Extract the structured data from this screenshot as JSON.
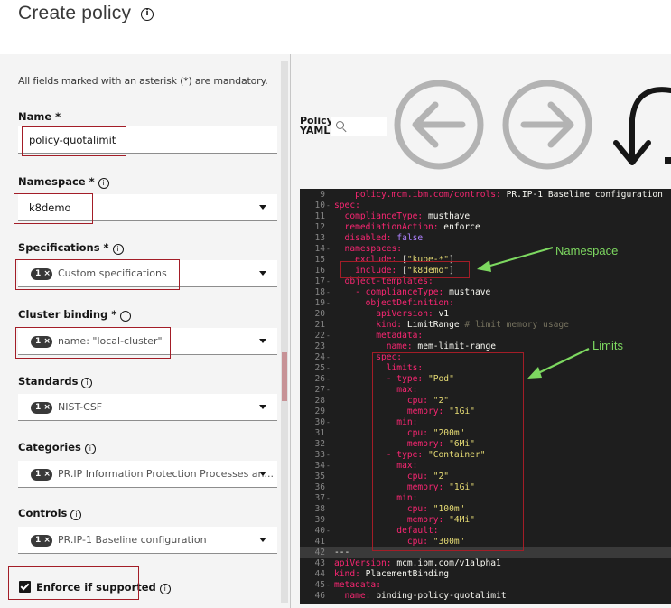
{
  "page": {
    "title": "Create policy"
  },
  "form": {
    "mandatory_note": "All fields marked with an asterisk (*) are mandatory.",
    "name": {
      "label": "Name *",
      "value": "policy-quotalimit"
    },
    "namespace": {
      "label": "Namespace *",
      "value": "k8demo"
    },
    "specifications": {
      "label": "Specifications *",
      "tag": "1",
      "value": "Custom specifications"
    },
    "cluster_binding": {
      "label": "Cluster binding *",
      "tag": "1",
      "value": "name: \"local-cluster\""
    },
    "standards": {
      "label": "Standards",
      "tag": "1",
      "value": "NIST-CSF"
    },
    "categories": {
      "label": "Categories",
      "tag": "1",
      "value": "PR.IP Information Protection Processes an..."
    },
    "controls": {
      "label": "Controls",
      "tag": "1",
      "value": "PR.IP-1 Baseline configuration"
    },
    "enforce": {
      "label": "Enforce if supported",
      "checked": true
    }
  },
  "yaml": {
    "label_line1": "Policy",
    "label_line2": "YAML",
    "lines": [
      {
        "n": "9",
        "fold": "",
        "seg": [
          [
            "    policy.mcm.ibm.com/controls: ",
            "k"
          ],
          [
            "PR.IP-1 Baseline configuration",
            "v"
          ]
        ]
      },
      {
        "n": "10",
        "fold": "-",
        "seg": [
          [
            "spec:",
            "k"
          ]
        ]
      },
      {
        "n": "11",
        "fold": "",
        "seg": [
          [
            "  complianceType: ",
            "k"
          ],
          [
            "musthave",
            "v"
          ]
        ]
      },
      {
        "n": "12",
        "fold": "",
        "seg": [
          [
            "  remediationAction: ",
            "k"
          ],
          [
            "enforce",
            "v"
          ]
        ]
      },
      {
        "n": "13",
        "fold": "",
        "seg": [
          [
            "  disabled: ",
            "k"
          ],
          [
            "false",
            "b"
          ]
        ]
      },
      {
        "n": "14",
        "fold": "-",
        "seg": [
          [
            "  namespaces:",
            "k"
          ]
        ]
      },
      {
        "n": "15",
        "fold": "",
        "seg": [
          [
            "    exclude: ",
            "k"
          ],
          [
            "[",
            "p"
          ],
          [
            "\"kube-*\"",
            "s"
          ],
          [
            "]",
            "p"
          ]
        ]
      },
      {
        "n": "16",
        "fold": "",
        "seg": [
          [
            "    include: ",
            "k"
          ],
          [
            "[",
            "p"
          ],
          [
            "\"k8demo\"",
            "s"
          ],
          [
            "]",
            "p"
          ]
        ]
      },
      {
        "n": "17",
        "fold": "-",
        "seg": [
          [
            "  object-templates:",
            "k"
          ]
        ]
      },
      {
        "n": "18",
        "fold": "-",
        "seg": [
          [
            "    - complianceType: ",
            "k"
          ],
          [
            "musthave",
            "v"
          ]
        ]
      },
      {
        "n": "19",
        "fold": "-",
        "seg": [
          [
            "      objectDefinition:",
            "k"
          ]
        ]
      },
      {
        "n": "20",
        "fold": "",
        "seg": [
          [
            "        apiVersion: ",
            "k"
          ],
          [
            "v1",
            "v"
          ]
        ]
      },
      {
        "n": "21",
        "fold": "",
        "seg": [
          [
            "        kind: ",
            "k"
          ],
          [
            "LimitRange ",
            "v"
          ],
          [
            "# limit memory usage",
            "c"
          ]
        ]
      },
      {
        "n": "22",
        "fold": "-",
        "seg": [
          [
            "        metadata:",
            "k"
          ]
        ]
      },
      {
        "n": "23",
        "fold": "",
        "seg": [
          [
            "          name: ",
            "k"
          ],
          [
            "mem-limit-range",
            "v"
          ]
        ]
      },
      {
        "n": "24",
        "fold": "-",
        "seg": [
          [
            "        spec:",
            "k"
          ]
        ]
      },
      {
        "n": "25",
        "fold": "-",
        "seg": [
          [
            "          limits:",
            "k"
          ]
        ]
      },
      {
        "n": "26",
        "fold": "-",
        "seg": [
          [
            "          - type: ",
            "k"
          ],
          [
            "\"Pod\"",
            "s"
          ]
        ]
      },
      {
        "n": "27",
        "fold": "-",
        "seg": [
          [
            "            max:",
            "k"
          ]
        ]
      },
      {
        "n": "28",
        "fold": "",
        "seg": [
          [
            "              cpu: ",
            "k"
          ],
          [
            "\"2\"",
            "s"
          ]
        ]
      },
      {
        "n": "29",
        "fold": "",
        "seg": [
          [
            "              memory: ",
            "k"
          ],
          [
            "\"1Gi\"",
            "s"
          ]
        ]
      },
      {
        "n": "30",
        "fold": "-",
        "seg": [
          [
            "            min:",
            "k"
          ]
        ]
      },
      {
        "n": "31",
        "fold": "",
        "seg": [
          [
            "              cpu: ",
            "k"
          ],
          [
            "\"200m\"",
            "s"
          ]
        ]
      },
      {
        "n": "32",
        "fold": "",
        "seg": [
          [
            "              memory: ",
            "k"
          ],
          [
            "\"6Mi\"",
            "s"
          ]
        ]
      },
      {
        "n": "33",
        "fold": "-",
        "seg": [
          [
            "          - type: ",
            "k"
          ],
          [
            "\"Container\"",
            "s"
          ]
        ]
      },
      {
        "n": "34",
        "fold": "-",
        "seg": [
          [
            "            max:",
            "k"
          ]
        ]
      },
      {
        "n": "35",
        "fold": "",
        "seg": [
          [
            "              cpu: ",
            "k"
          ],
          [
            "\"2\"",
            "s"
          ]
        ]
      },
      {
        "n": "36",
        "fold": "",
        "seg": [
          [
            "              memory: ",
            "k"
          ],
          [
            "\"1Gi\"",
            "s"
          ]
        ]
      },
      {
        "n": "37",
        "fold": "-",
        "seg": [
          [
            "            min:",
            "k"
          ]
        ]
      },
      {
        "n": "38",
        "fold": "",
        "seg": [
          [
            "              cpu: ",
            "k"
          ],
          [
            "\"100m\"",
            "s"
          ]
        ]
      },
      {
        "n": "39",
        "fold": "",
        "seg": [
          [
            "              memory: ",
            "k"
          ],
          [
            "\"4Mi\"",
            "s"
          ]
        ]
      },
      {
        "n": "40",
        "fold": "-",
        "seg": [
          [
            "            default:",
            "k"
          ]
        ]
      },
      {
        "n": "41",
        "fold": "",
        "seg": [
          [
            "              cpu: ",
            "k"
          ],
          [
            "\"300m\"",
            "s"
          ]
        ]
      },
      {
        "n": "42",
        "fold": "",
        "active": true,
        "seg": [
          [
            "---",
            "v"
          ]
        ]
      },
      {
        "n": "43",
        "fold": "",
        "seg": [
          [
            "apiVersion: ",
            "k"
          ],
          [
            "mcm.ibm.com/v1alpha1",
            "v"
          ]
        ]
      },
      {
        "n": "44",
        "fold": "",
        "seg": [
          [
            "kind: ",
            "k"
          ],
          [
            "PlacementBinding",
            "v"
          ]
        ]
      },
      {
        "n": "45",
        "fold": "-",
        "seg": [
          [
            "metadata:",
            "k"
          ]
        ]
      },
      {
        "n": "46",
        "fold": "",
        "seg": [
          [
            "  name: ",
            "k"
          ],
          [
            "binding-policy-quotalimit",
            "v"
          ]
        ]
      }
    ]
  },
  "annotations": {
    "namespace": "Namespace",
    "limits": "Limits"
  },
  "colors": {
    "highlight": "#a31d27",
    "annotation": "#7dd860",
    "editor_bg": "#1e1e1e"
  },
  "icons": [
    "info-icon",
    "search-icon",
    "undo-arrow-icon",
    "redo-arrow-icon",
    "reset-arrow-icon",
    "chevron-down-icon",
    "checkbox-checked-icon"
  ]
}
